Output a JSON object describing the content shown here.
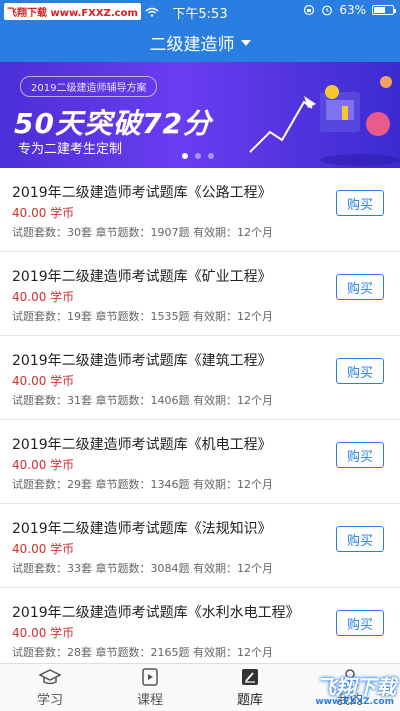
{
  "status_bar": {
    "watermark": "飞翔下载 www.FXXZ.com",
    "time": "下午5:53",
    "battery": "63%",
    "battery_level": 0.63
  },
  "header": {
    "title": "二级建造师"
  },
  "banner": {
    "tag": "2019二级建造师辅导方案",
    "headline": "50天突破72分",
    "subtitle": "专为二建考生定制",
    "active_slide": 1,
    "slide_count": 3
  },
  "courses": [
    {
      "title": "2019年二级建造师考试题库《公路工程》",
      "price": "40.00 学币",
      "meta": "试题套数：30套   章节题数：1907题   有效期：12个月",
      "button": "购买"
    },
    {
      "title": "2019年二级建造师考试题库《矿业工程》",
      "price": "40.00 学币",
      "meta": "试题套数：19套   章节题数：1535题   有效期：12个月",
      "button": "购买"
    },
    {
      "title": "2019年二级建造师考试题库《建筑工程》",
      "price": "40.00 学币",
      "meta": "试题套数：31套   章节题数：1406题   有效期：12个月",
      "button": "购买"
    },
    {
      "title": "2019年二级建造师考试题库《机电工程》",
      "price": "40.00 学币",
      "meta": "试题套数：29套   章节题数：1346题   有效期：12个月",
      "button": "购买"
    },
    {
      "title": "2019年二级建造师考试题库《法规知识》",
      "price": "40.00 学币",
      "meta": "试题套数：33套   章节题数：3084题   有效期：12个月",
      "button": "购买"
    },
    {
      "title": "2019年二级建造师考试题库《水利水电工程》",
      "price": "40.00 学币",
      "meta": "试题套数：28套   章节题数：2165题   有效期：12个月",
      "button": "购买"
    }
  ],
  "tabbar": {
    "tabs": [
      {
        "label": "学习",
        "icon": "graduation-cap-icon"
      },
      {
        "label": "课程",
        "icon": "play-document-icon"
      },
      {
        "label": "题库",
        "icon": "pen-edit-icon",
        "active": true
      },
      {
        "label": "我的",
        "icon": "person-icon"
      }
    ]
  },
  "watermark_br": {
    "main": "飞翔下载",
    "sub": "www.FXXZ.com"
  },
  "colors": {
    "primary": "#2a7de1",
    "price": "#d0302d",
    "banner_start": "#4b2fd6",
    "banner_end": "#3b2bd0"
  }
}
